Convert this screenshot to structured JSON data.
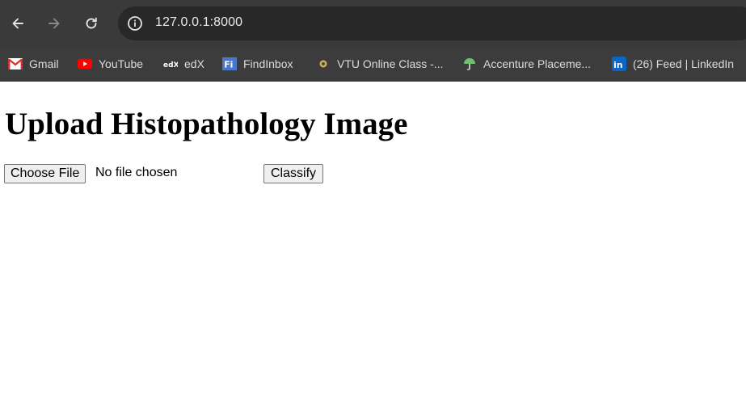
{
  "browser": {
    "url": "127.0.0.1:8000",
    "icons": {
      "back": "back-arrow-icon",
      "forward": "forward-arrow-icon",
      "reload": "reload-icon",
      "site_info": "info-icon"
    },
    "bookmarks": [
      {
        "label": "Gmail",
        "icon": "gmail-icon"
      },
      {
        "label": "YouTube",
        "icon": "youtube-icon"
      },
      {
        "label": "edX",
        "icon": "edx-icon"
      },
      {
        "label": "FindInbox",
        "icon": "findinbox-icon"
      },
      {
        "label": "VTU Online Class -...",
        "icon": "vtu-icon"
      },
      {
        "label": "Accenture Placeme...",
        "icon": "accenture-icon"
      },
      {
        "label": "(26) Feed | LinkedIn",
        "icon": "linkedin-icon"
      }
    ]
  },
  "page": {
    "title": "Upload Histopathology Image",
    "file_input": {
      "button_label": "Choose File",
      "status": "No file chosen"
    },
    "classify_label": "Classify"
  }
}
